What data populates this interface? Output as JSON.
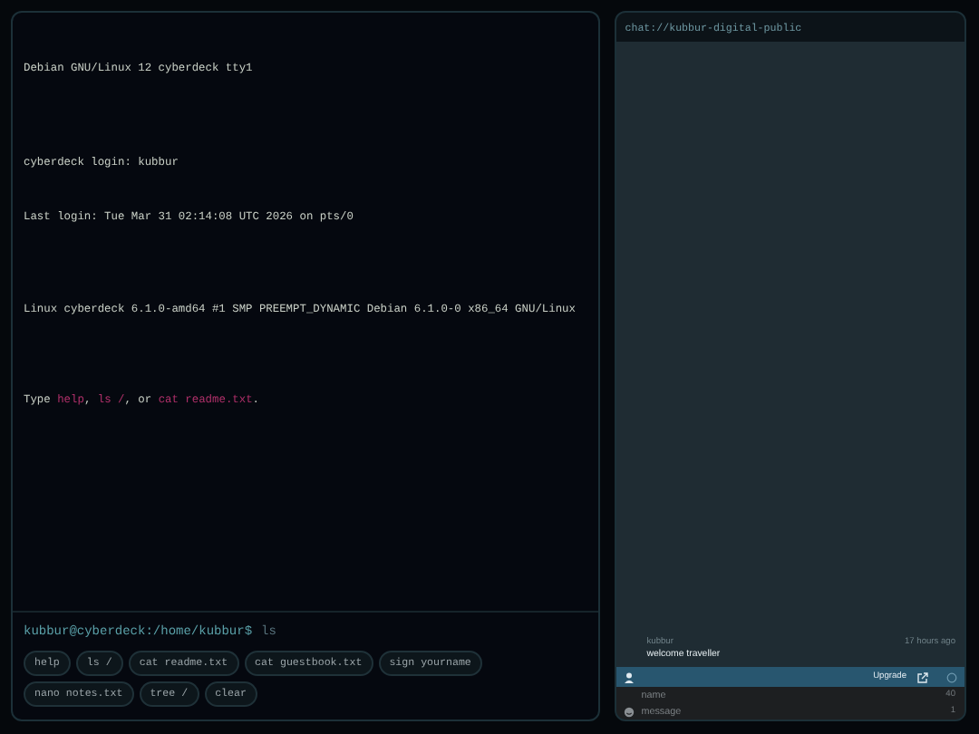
{
  "terminal": {
    "lines": [
      {
        "segments": [
          {
            "text": "Debian GNU/Linux 12 cyberdeck tty1",
            "kind": "plain"
          }
        ]
      },
      {
        "segments": [
          {
            "text": "cyberdeck login: kubbur",
            "kind": "plain"
          }
        ]
      },
      {
        "segments": [
          {
            "text": "Last login: Tue Mar 31 02:14:08 UTC 2026 on pts/0",
            "kind": "plain"
          }
        ]
      },
      {
        "segments": [
          {
            "text": "Linux cyberdeck 6.1.0-amd64 #1 SMP PREEMPT_DYNAMIC Debian 6.1.0-0 x86_64 GNU/Linux",
            "kind": "plain"
          }
        ]
      },
      {
        "segments": [
          {
            "text": "Type ",
            "kind": "plain"
          },
          {
            "text": "help",
            "kind": "command"
          },
          {
            "text": ", ",
            "kind": "plain"
          },
          {
            "text": "ls /",
            "kind": "command"
          },
          {
            "text": ", or ",
            "kind": "plain"
          },
          {
            "text": "cat readme.txt",
            "kind": "command"
          },
          {
            "text": ".",
            "kind": "plain"
          }
        ]
      }
    ],
    "prompt": "kubbur@cyberdeck:/home/kubbur$",
    "input": "ls",
    "suggestions": [
      "help",
      "ls /",
      "cat readme.txt",
      "cat guestbook.txt",
      "sign yourname",
      "nano notes.txt",
      "tree /",
      "clear"
    ]
  },
  "chat": {
    "title": "chat://kubbur-digital-public",
    "messages": [
      {
        "author": "kubbur",
        "time": "17 hours ago",
        "text": "welcome traveller"
      }
    ],
    "toolbar": {
      "upgrade": "Upgrade"
    },
    "name_field": {
      "placeholder": "name",
      "counter": "40"
    },
    "message_field": {
      "placeholder": "message",
      "counter": "1"
    }
  }
}
